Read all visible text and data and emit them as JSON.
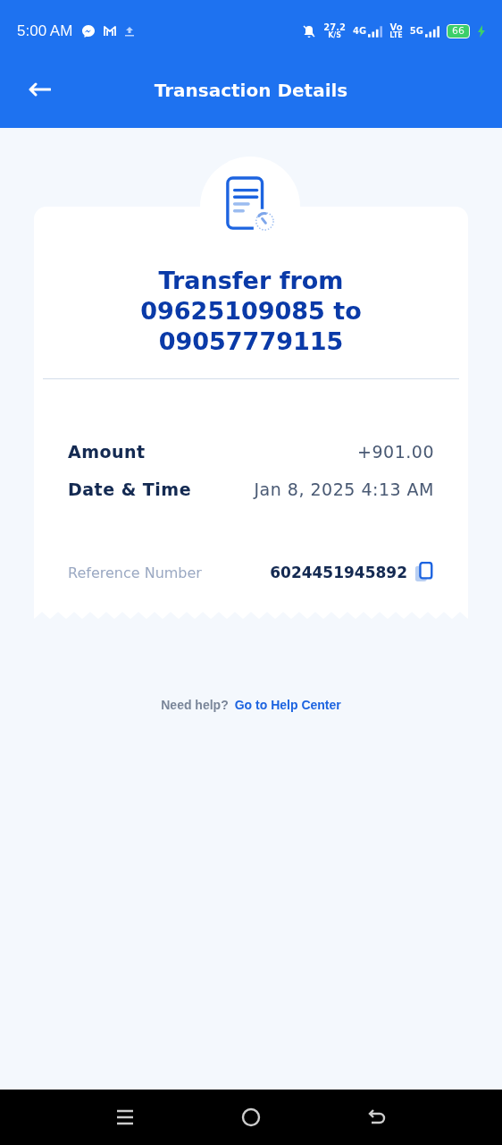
{
  "status_bar": {
    "time": "5:00 AM",
    "speed": "27.2",
    "speed_unit": "K/S",
    "network_1": "4G",
    "volte_top": "Vo",
    "volte_bottom": "LTE",
    "network_2": "5G",
    "battery": "66"
  },
  "header": {
    "title": "Transaction Details"
  },
  "receipt": {
    "title": "Transfer from 09625109085 to 09057779115",
    "details": [
      {
        "label": "Amount",
        "value": "+901.00"
      },
      {
        "label": "Date & Time",
        "value": "Jan 8, 2025 4:13 AM"
      }
    ],
    "reference": {
      "label": "Reference Number",
      "value": "6024451945892"
    }
  },
  "help": {
    "text": "Need help?",
    "link": "Go to Help Center"
  }
}
